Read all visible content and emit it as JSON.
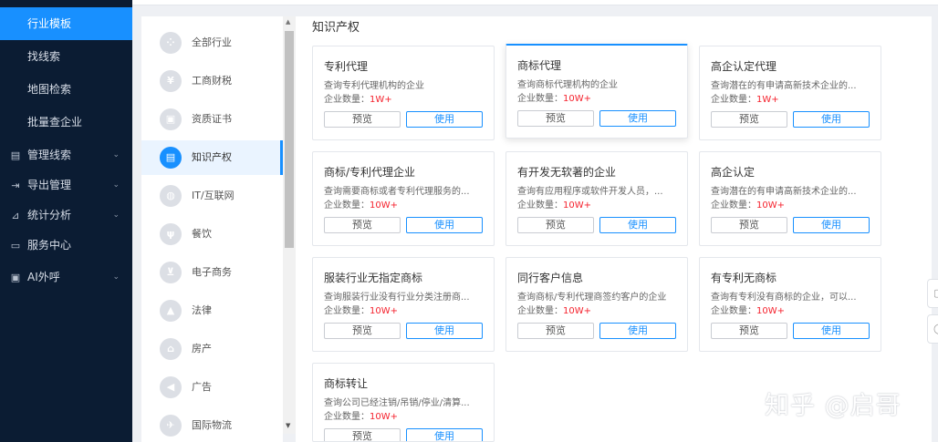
{
  "nav": {
    "sub_items": [
      {
        "label": "行业模板",
        "active": true
      },
      {
        "label": "找线索",
        "active": false
      },
      {
        "label": "地图检索",
        "active": false
      },
      {
        "label": "批量查企业",
        "active": false
      }
    ],
    "groups": [
      {
        "label": "管理线索",
        "icon": "list-icon",
        "glyph": "▤",
        "chevron": true
      },
      {
        "label": "导出管理",
        "icon": "export-icon",
        "glyph": "⇥",
        "chevron": true
      },
      {
        "label": "统计分析",
        "icon": "chart-icon",
        "glyph": "⊿",
        "chevron": true
      },
      {
        "label": "服务中心",
        "icon": "service-icon",
        "glyph": "▭",
        "chevron": false
      },
      {
        "label": "AI外呼",
        "icon": "ai-call-icon",
        "glyph": "▣",
        "chevron": true
      }
    ]
  },
  "categories": [
    {
      "label": "全部行业",
      "icon": "grid-icon",
      "glyph": "⁘",
      "active": false
    },
    {
      "label": "工商财税",
      "icon": "yen-icon",
      "glyph": "¥",
      "active": false
    },
    {
      "label": "资质证书",
      "icon": "certificate-icon",
      "glyph": "▣",
      "active": false
    },
    {
      "label": "知识产权",
      "icon": "ip-icon",
      "glyph": "▤",
      "active": true
    },
    {
      "label": "IT/互联网",
      "icon": "globe-icon",
      "glyph": "◍",
      "active": false
    },
    {
      "label": "餐饮",
      "icon": "dining-icon",
      "glyph": "ψ",
      "active": false
    },
    {
      "label": "电子商务",
      "icon": "cart-icon",
      "glyph": "⊻",
      "active": false
    },
    {
      "label": "法律",
      "icon": "law-icon",
      "glyph": "▲",
      "active": false
    },
    {
      "label": "房产",
      "icon": "house-icon",
      "glyph": "⌂",
      "active": false
    },
    {
      "label": "广告",
      "icon": "megaphone-icon",
      "glyph": "◀",
      "active": false
    },
    {
      "label": "国际物流",
      "icon": "plane-icon",
      "glyph": "✈",
      "active": false
    }
  ],
  "main": {
    "title": "知识产权",
    "preview_label": "预览",
    "use_label": "使用",
    "count_prefix": "企业数量：",
    "cards": [
      {
        "title": "专利代理",
        "desc": "查询专利代理机构的企业",
        "count": "1W+"
      },
      {
        "title": "商标代理",
        "desc": "查询商标代理机构的企业",
        "count": "10W+"
      },
      {
        "title": "高企认定代理",
        "desc": "查询潜在的有申请高新技术企业的...",
        "count": "1W+"
      },
      {
        "title": "商标/专利代理企业",
        "desc": "查询需要商标或者专利代理服务的...",
        "count": "10W+"
      },
      {
        "title": "有开发无软著的企业",
        "desc": "查询有应用程序或软件开发人员，...",
        "count": "10W+"
      },
      {
        "title": "高企认定",
        "desc": "查询潜在的有申请高新技术企业的...",
        "count": "10W+"
      },
      {
        "title": "服装行业无指定商标",
        "desc": "查询服装行业没有行业分类注册商...",
        "count": "10W+"
      },
      {
        "title": "同行客户信息",
        "desc": "查询商标/专利代理商签约客户的企业",
        "count": "10W+"
      },
      {
        "title": "有专利无商标",
        "desc": "查询有专利没有商标的企业，可以...",
        "count": "10W+"
      },
      {
        "title": "商标转让",
        "desc": "查询公司已经注销/吊销/停业/清算...",
        "count": "10W+"
      }
    ]
  },
  "watermark": "知乎 @启哥",
  "colors": {
    "accent": "#1890ff",
    "nav_bg": "#0b1c33",
    "count_red": "#f5222d"
  }
}
